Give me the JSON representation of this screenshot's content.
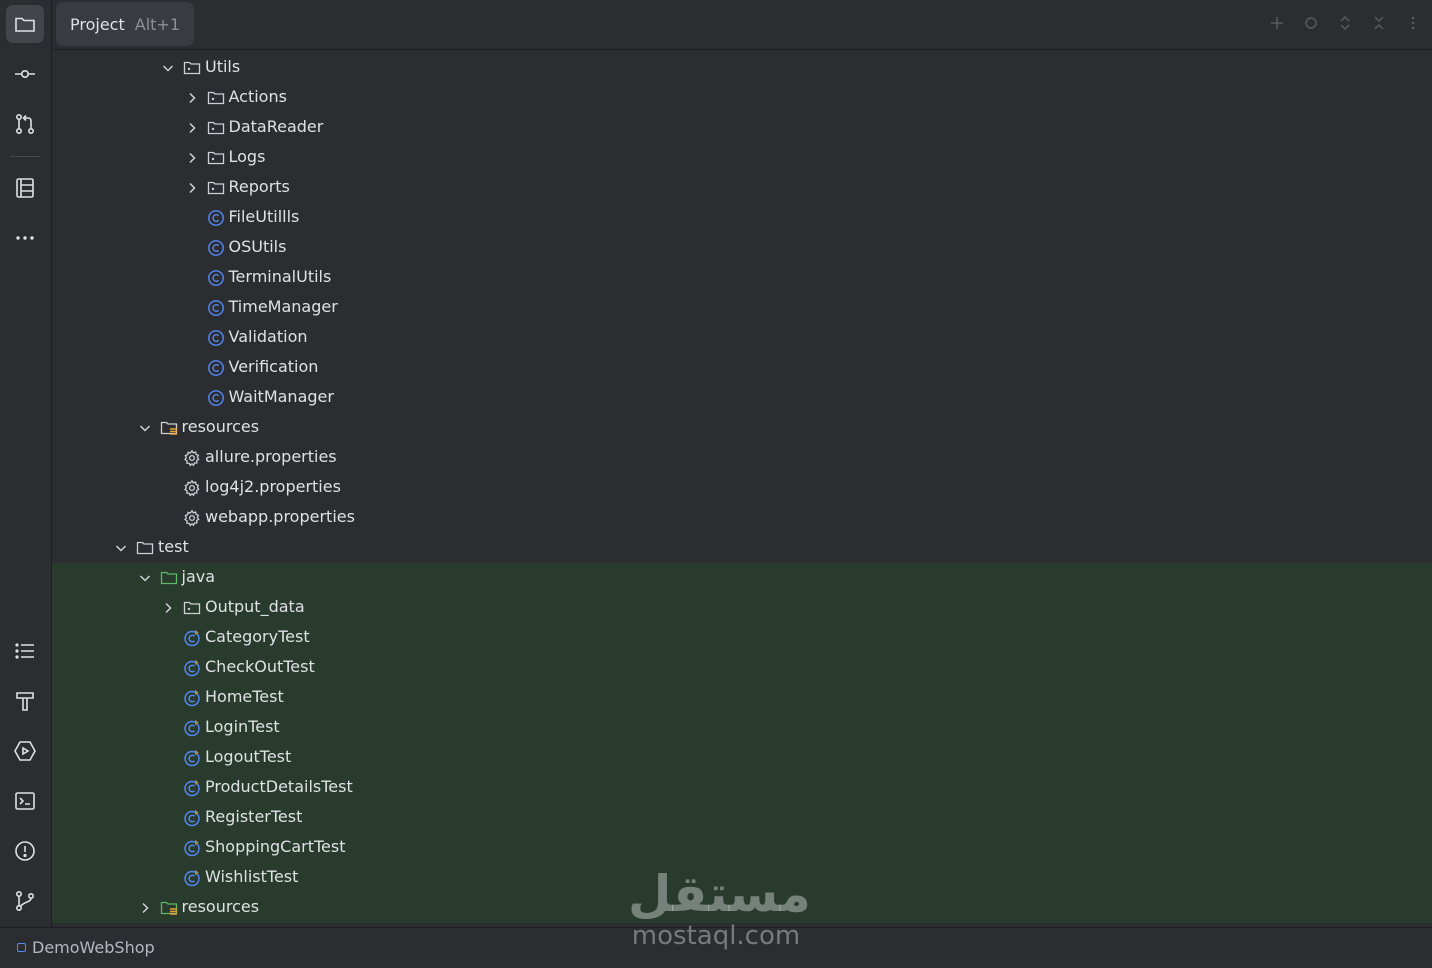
{
  "header": {
    "tab_label": "Project",
    "tab_shortcut": "Alt+1"
  },
  "tree": [
    {
      "label": "Utils",
      "kind": "package",
      "depth": 2,
      "chevron": "down",
      "section": "main"
    },
    {
      "label": "Actions",
      "kind": "package",
      "depth": 3,
      "chevron": "right",
      "section": "main"
    },
    {
      "label": "DataReader",
      "kind": "package",
      "depth": 3,
      "chevron": "right",
      "section": "main"
    },
    {
      "label": "Logs",
      "kind": "package",
      "depth": 3,
      "chevron": "right",
      "section": "main"
    },
    {
      "label": "Reports",
      "kind": "package",
      "depth": 3,
      "chevron": "right",
      "section": "main"
    },
    {
      "label": "FileUtillls",
      "kind": "class",
      "depth": 3,
      "chevron": "none",
      "section": "main"
    },
    {
      "label": "OSUtils",
      "kind": "class",
      "depth": 3,
      "chevron": "none",
      "section": "main"
    },
    {
      "label": "TerminalUtils",
      "kind": "class",
      "depth": 3,
      "chevron": "none",
      "section": "main"
    },
    {
      "label": "TimeManager",
      "kind": "class",
      "depth": 3,
      "chevron": "none",
      "section": "main"
    },
    {
      "label": "Validation",
      "kind": "class",
      "depth": 3,
      "chevron": "none",
      "section": "main"
    },
    {
      "label": "Verification",
      "kind": "class",
      "depth": 3,
      "chevron": "none",
      "section": "main"
    },
    {
      "label": "WaitManager",
      "kind": "class",
      "depth": 3,
      "chevron": "none",
      "section": "main"
    },
    {
      "label": "resources",
      "kind": "resources",
      "depth": 1,
      "chevron": "down",
      "section": "main"
    },
    {
      "label": "allure.properties",
      "kind": "properties",
      "depth": 2,
      "chevron": "none",
      "section": "main"
    },
    {
      "label": "log4j2.properties",
      "kind": "properties",
      "depth": 2,
      "chevron": "none",
      "section": "main"
    },
    {
      "label": "webapp.properties",
      "kind": "properties",
      "depth": 2,
      "chevron": "none",
      "section": "main"
    },
    {
      "label": "test",
      "kind": "folder",
      "depth": 0,
      "chevron": "down",
      "section": "main"
    },
    {
      "label": "java",
      "kind": "test-root",
      "depth": 1,
      "chevron": "down",
      "section": "test"
    },
    {
      "label": "Output_data",
      "kind": "package",
      "depth": 2,
      "chevron": "right",
      "section": "test"
    },
    {
      "label": "CategoryTest",
      "kind": "test-class",
      "depth": 2,
      "chevron": "none",
      "section": "test"
    },
    {
      "label": "CheckOutTest",
      "kind": "test-class",
      "depth": 2,
      "chevron": "none",
      "section": "test"
    },
    {
      "label": "HomeTest",
      "kind": "test-class",
      "depth": 2,
      "chevron": "none",
      "section": "test"
    },
    {
      "label": "LoginTest",
      "kind": "test-class",
      "depth": 2,
      "chevron": "none",
      "section": "test"
    },
    {
      "label": "LogoutTest",
      "kind": "test-class",
      "depth": 2,
      "chevron": "none",
      "section": "test"
    },
    {
      "label": "ProductDetailsTest",
      "kind": "test-class",
      "depth": 2,
      "chevron": "none",
      "section": "test"
    },
    {
      "label": "RegisterTest",
      "kind": "test-class",
      "depth": 2,
      "chevron": "none",
      "section": "test"
    },
    {
      "label": "ShoppingCartTest",
      "kind": "test-class",
      "depth": 2,
      "chevron": "none",
      "section": "test"
    },
    {
      "label": "WishlistTest",
      "kind": "test-class",
      "depth": 2,
      "chevron": "none",
      "section": "test"
    },
    {
      "label": "resources",
      "kind": "test-resources",
      "depth": 1,
      "chevron": "right",
      "section": "test"
    }
  ],
  "toolbar_icons": [
    "project-folder-icon",
    "commit-icon",
    "pull-requests-icon",
    "structure-icon",
    "more-icon",
    "todo-list-icon",
    "build-hammer-icon",
    "services-run-icon",
    "terminal-icon",
    "problems-icon",
    "git-branch-icon"
  ],
  "colors": {
    "class_blue": "#548af7",
    "test_green": "#5fb865",
    "test_bg": "#283b2d",
    "panel_bg": "#2b2d30"
  },
  "status": {
    "project_name": "DemoWebShop"
  },
  "watermark": {
    "arabic": "مستقل",
    "latin": "mostaql.com"
  }
}
